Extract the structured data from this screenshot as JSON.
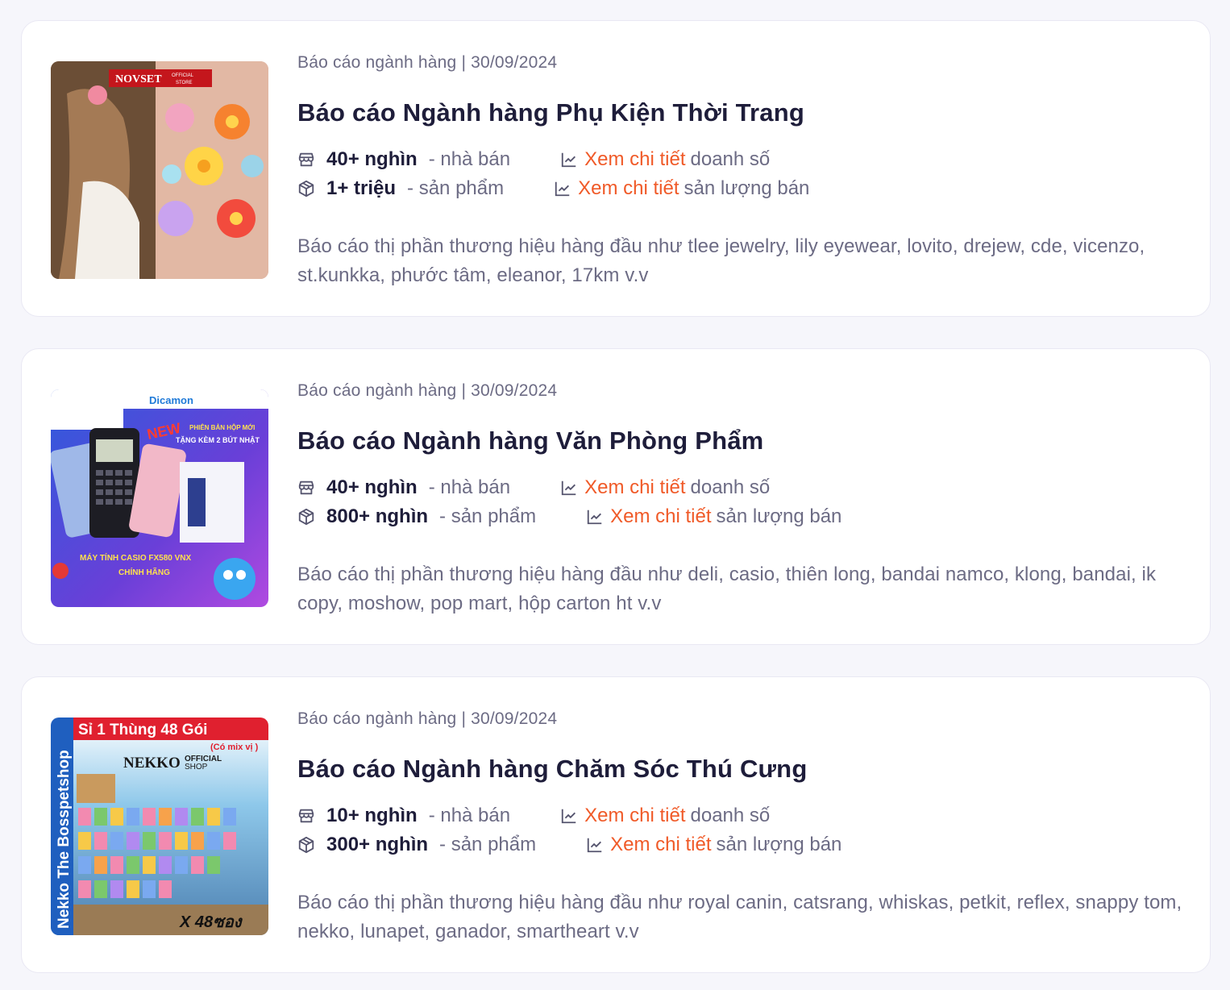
{
  "cards": [
    {
      "category": "Báo cáo ngành hàng",
      "date": "30/09/2024",
      "title": "Báo cáo Ngành hàng Phụ Kiện Thời Trang",
      "sellers_value": "40+ nghìn",
      "sellers_unit": "- nhà bán",
      "products_value": "1+ triệu",
      "products_unit": "- sản phẩm",
      "link_revenue": "Xem chi tiết",
      "link_revenue_text": "doanh số",
      "link_volume": "Xem chi tiết",
      "link_volume_text": "sản lượng bán",
      "description": "Báo cáo thị phần thương hiệu hàng đầu như tlee jewelry, lily eyewear, lovito, drejew, cde, vicenzo, st.kunkka, phước tâm, eleanor, 17km v.v",
      "image_text": {
        "brand": "NOVSET",
        "badge": "OFFICIAL STORE"
      }
    },
    {
      "category": "Báo cáo ngành hàng",
      "date": "30/09/2024",
      "title": "Báo cáo Ngành hàng Văn Phòng Phẩm",
      "sellers_value": "40+ nghìn",
      "sellers_unit": "- nhà bán",
      "products_value": "800+ nghìn",
      "products_unit": "- sản phẩm",
      "link_revenue": "Xem chi tiết",
      "link_revenue_text": "doanh số",
      "link_volume": "Xem chi tiết",
      "link_volume_text": "sản lượng bán",
      "description": "Báo cáo thị phần thương hiệu hàng đầu như deli, casio, thiên long, bandai namco, klong, bandai, ik copy, moshow, pop mart, hộp carton ht v.v",
      "image_text": {
        "brand": "Dicamon",
        "new": "NEW",
        "promo": "PHIÊN BẢN HỘP MỚI TẶNG KÈM 2 BÚT NHẬT",
        "product": "MÁY TÍNH CASIO FX580 VNX CHÍNH HÃNG"
      }
    },
    {
      "category": "Báo cáo ngành hàng",
      "date": "30/09/2024",
      "title": "Báo cáo Ngành hàng Chăm Sóc Thú Cưng",
      "sellers_value": "10+ nghìn",
      "sellers_unit": "- nhà bán",
      "products_value": "300+ nghìn",
      "products_unit": "- sản phẩm",
      "link_revenue": "Xem chi tiết",
      "link_revenue_text": "doanh số",
      "link_volume": "Xem chi tiết",
      "link_volume_text": "sản lượng bán",
      "description": "Báo cáo thị phần thương hiệu hàng đầu như royal canin, catsrang, whiskas, petkit, reflex, snappy tom, nekko, lunapet, ganador, smartheart v.v",
      "image_text": {
        "banner": "Sỉ 1 Thùng 48 Gói",
        "sub": "(Có mix vị )",
        "brand": "NEKKO",
        "shop": "OFFICIAL SHOP",
        "side": "Nekko The Bosspetshop",
        "qty": "X 48ซอง"
      }
    }
  ],
  "colors": {
    "link": "#f05a28",
    "title": "#1e1d3a",
    "muted": "#6c6b84"
  }
}
